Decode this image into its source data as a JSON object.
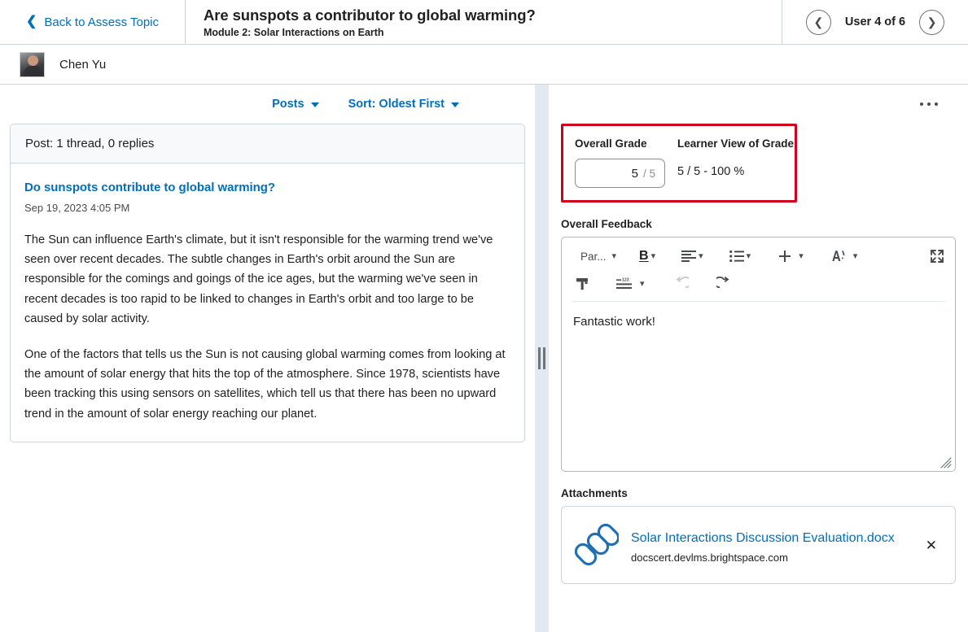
{
  "header": {
    "back_label": "Back to Assess Topic",
    "back_icon": "chevron-left-icon",
    "title": "Are sunspots a contributor to global warming?",
    "subtitle": "Module 2: Solar Interactions on Earth",
    "prev_icon": "chevron-left-circle-icon",
    "next_icon": "chevron-right-circle-icon",
    "user_counter": "User 4 of 6"
  },
  "user": {
    "name": "Chen Yu",
    "avatar_icon": "user-photo-avatar"
  },
  "left_panel": {
    "posts_filter_label": "Posts",
    "sort_label": "Sort: Oldest First",
    "thread_summary": "Post: 1 thread, 0 replies",
    "post": {
      "title": "Do sunspots contribute to global warming?",
      "date": "Sep 19, 2023 4:05 PM",
      "paragraph1": "The Sun can influence Earth's climate, but it isn't responsible for the warming trend we've seen over recent decades. The subtle changes in Earth's orbit around the Sun are responsible for the comings and goings of the ice ages, but the warming we've seen in recent decades is too rapid to be linked to changes in Earth's orbit and too large to be caused by solar activity.",
      "paragraph2": "One of the factors that tells us the Sun is not causing global warming comes from looking at the amount of solar energy that hits the top of the atmosphere. Since 1978, scientists have been tracking this using sensors on satellites, which tell us that there has been no upward trend in the amount of solar energy reaching our planet."
    }
  },
  "right_panel": {
    "more_options_icon": "ellipsis-icon",
    "grade": {
      "overall_grade_label": "Overall Grade",
      "learner_view_label": "Learner View of Grade",
      "score_value": "5",
      "score_denominator": "/ 5",
      "learner_view_value": "5 / 5 - 100 %",
      "highlight_color": "#d0021b"
    },
    "feedback": {
      "label": "Overall Feedback",
      "content": "Fantastic work!",
      "toolbar": {
        "paragraph_label": "Par...",
        "bold_label": "B",
        "items": [
          "paragraph-format-dropdown",
          "bold-icon",
          "align-left-icon",
          "bulleted-list-icon",
          "insert-plus-icon",
          "font-style-icon",
          "fullscreen-icon",
          "format-painter-icon",
          "numbered-list-icon",
          "undo-icon",
          "redo-icon"
        ]
      },
      "resize_icon": "resize-grip-icon"
    },
    "attachments": {
      "label": "Attachments",
      "items": [
        {
          "icon": "link-chain-icon",
          "name": "Solar Interactions Discussion Evaluation.docx",
          "host": "docscert.devlms.brightspace.com",
          "remove_icon": "close-x-icon"
        }
      ]
    }
  },
  "splitter": {
    "icon": "vertical-drag-handle-icon"
  },
  "colors": {
    "link": "#006fbf",
    "text": "#202122",
    "border": "#cdd5dc",
    "alert": "#d0021b"
  }
}
